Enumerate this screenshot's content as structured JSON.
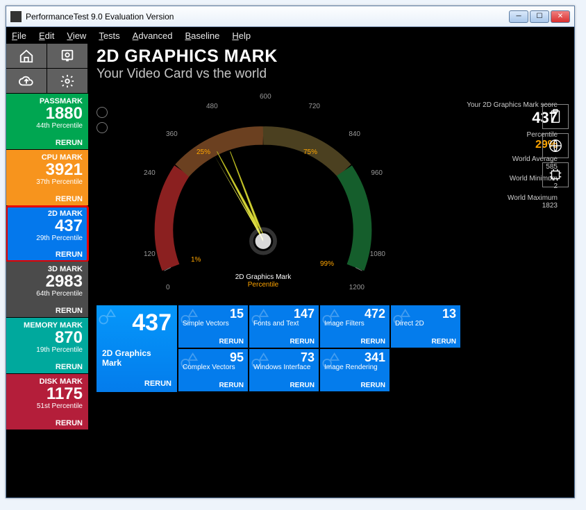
{
  "window": {
    "title": "PerformanceTest 9.0 Evaluation Version"
  },
  "menus": {
    "file": "File",
    "edit": "Edit",
    "view": "View",
    "tests": "Tests",
    "advanced": "Advanced",
    "baseline": "Baseline",
    "help": "Help"
  },
  "header": {
    "title": "2D GRAPHICS MARK",
    "subtitle": "Your Video Card vs the world"
  },
  "gauge": {
    "ticks": [
      "0",
      "120",
      "240",
      "360",
      "480",
      "600",
      "720",
      "840",
      "960",
      "1080",
      "1200"
    ],
    "pct_labels": [
      "1%",
      "25%",
      "75%",
      "99%"
    ],
    "caption": "2D Graphics Mark",
    "caption2": "Percentile"
  },
  "stats": {
    "score_label": "Your 2D Graphics Mark score",
    "score": "437",
    "pct_label": "Percentile",
    "pct": "29%",
    "avg_label": "World Average",
    "avg": "585",
    "min_label": "World Minimum",
    "min": "2",
    "max_label": "World Maximum",
    "max": "1823"
  },
  "sidebar": [
    {
      "key": "passmark",
      "label": "PASSMARK",
      "score": "1880",
      "pct": "44th Percentile",
      "rerun": "RERUN"
    },
    {
      "key": "cpu",
      "label": "CPU MARK",
      "score": "3921",
      "pct": "37th Percentile",
      "rerun": "RERUN"
    },
    {
      "key": "d2",
      "label": "2D MARK",
      "score": "437",
      "pct": "29th Percentile",
      "rerun": "RERUN"
    },
    {
      "key": "d3",
      "label": "3D MARK",
      "score": "2983",
      "pct": "64th Percentile",
      "rerun": "RERUN"
    },
    {
      "key": "mem",
      "label": "MEMORY MARK",
      "score": "870",
      "pct": "19th Percentile",
      "rerun": "RERUN"
    },
    {
      "key": "disk",
      "label": "DISK MARK",
      "score": "1175",
      "pct": "51st Percentile",
      "rerun": "RERUN"
    }
  ],
  "bigtest": {
    "score": "437",
    "name": "2D Graphics Mark",
    "rerun": "RERUN"
  },
  "tests": [
    {
      "name": "Simple Vectors",
      "score": "15",
      "rerun": "RERUN"
    },
    {
      "name": "Fonts and Text",
      "score": "147",
      "rerun": "RERUN"
    },
    {
      "name": "Image Filters",
      "score": "472",
      "rerun": "RERUN"
    },
    {
      "name": "Direct 2D",
      "score": "13",
      "rerun": "RERUN"
    },
    {
      "name": "Complex Vectors",
      "score": "95",
      "rerun": "RERUN"
    },
    {
      "name": "Windows Interface",
      "score": "73",
      "rerun": "RERUN"
    },
    {
      "name": "Image Rendering",
      "score": "341",
      "rerun": "RERUN"
    }
  ]
}
